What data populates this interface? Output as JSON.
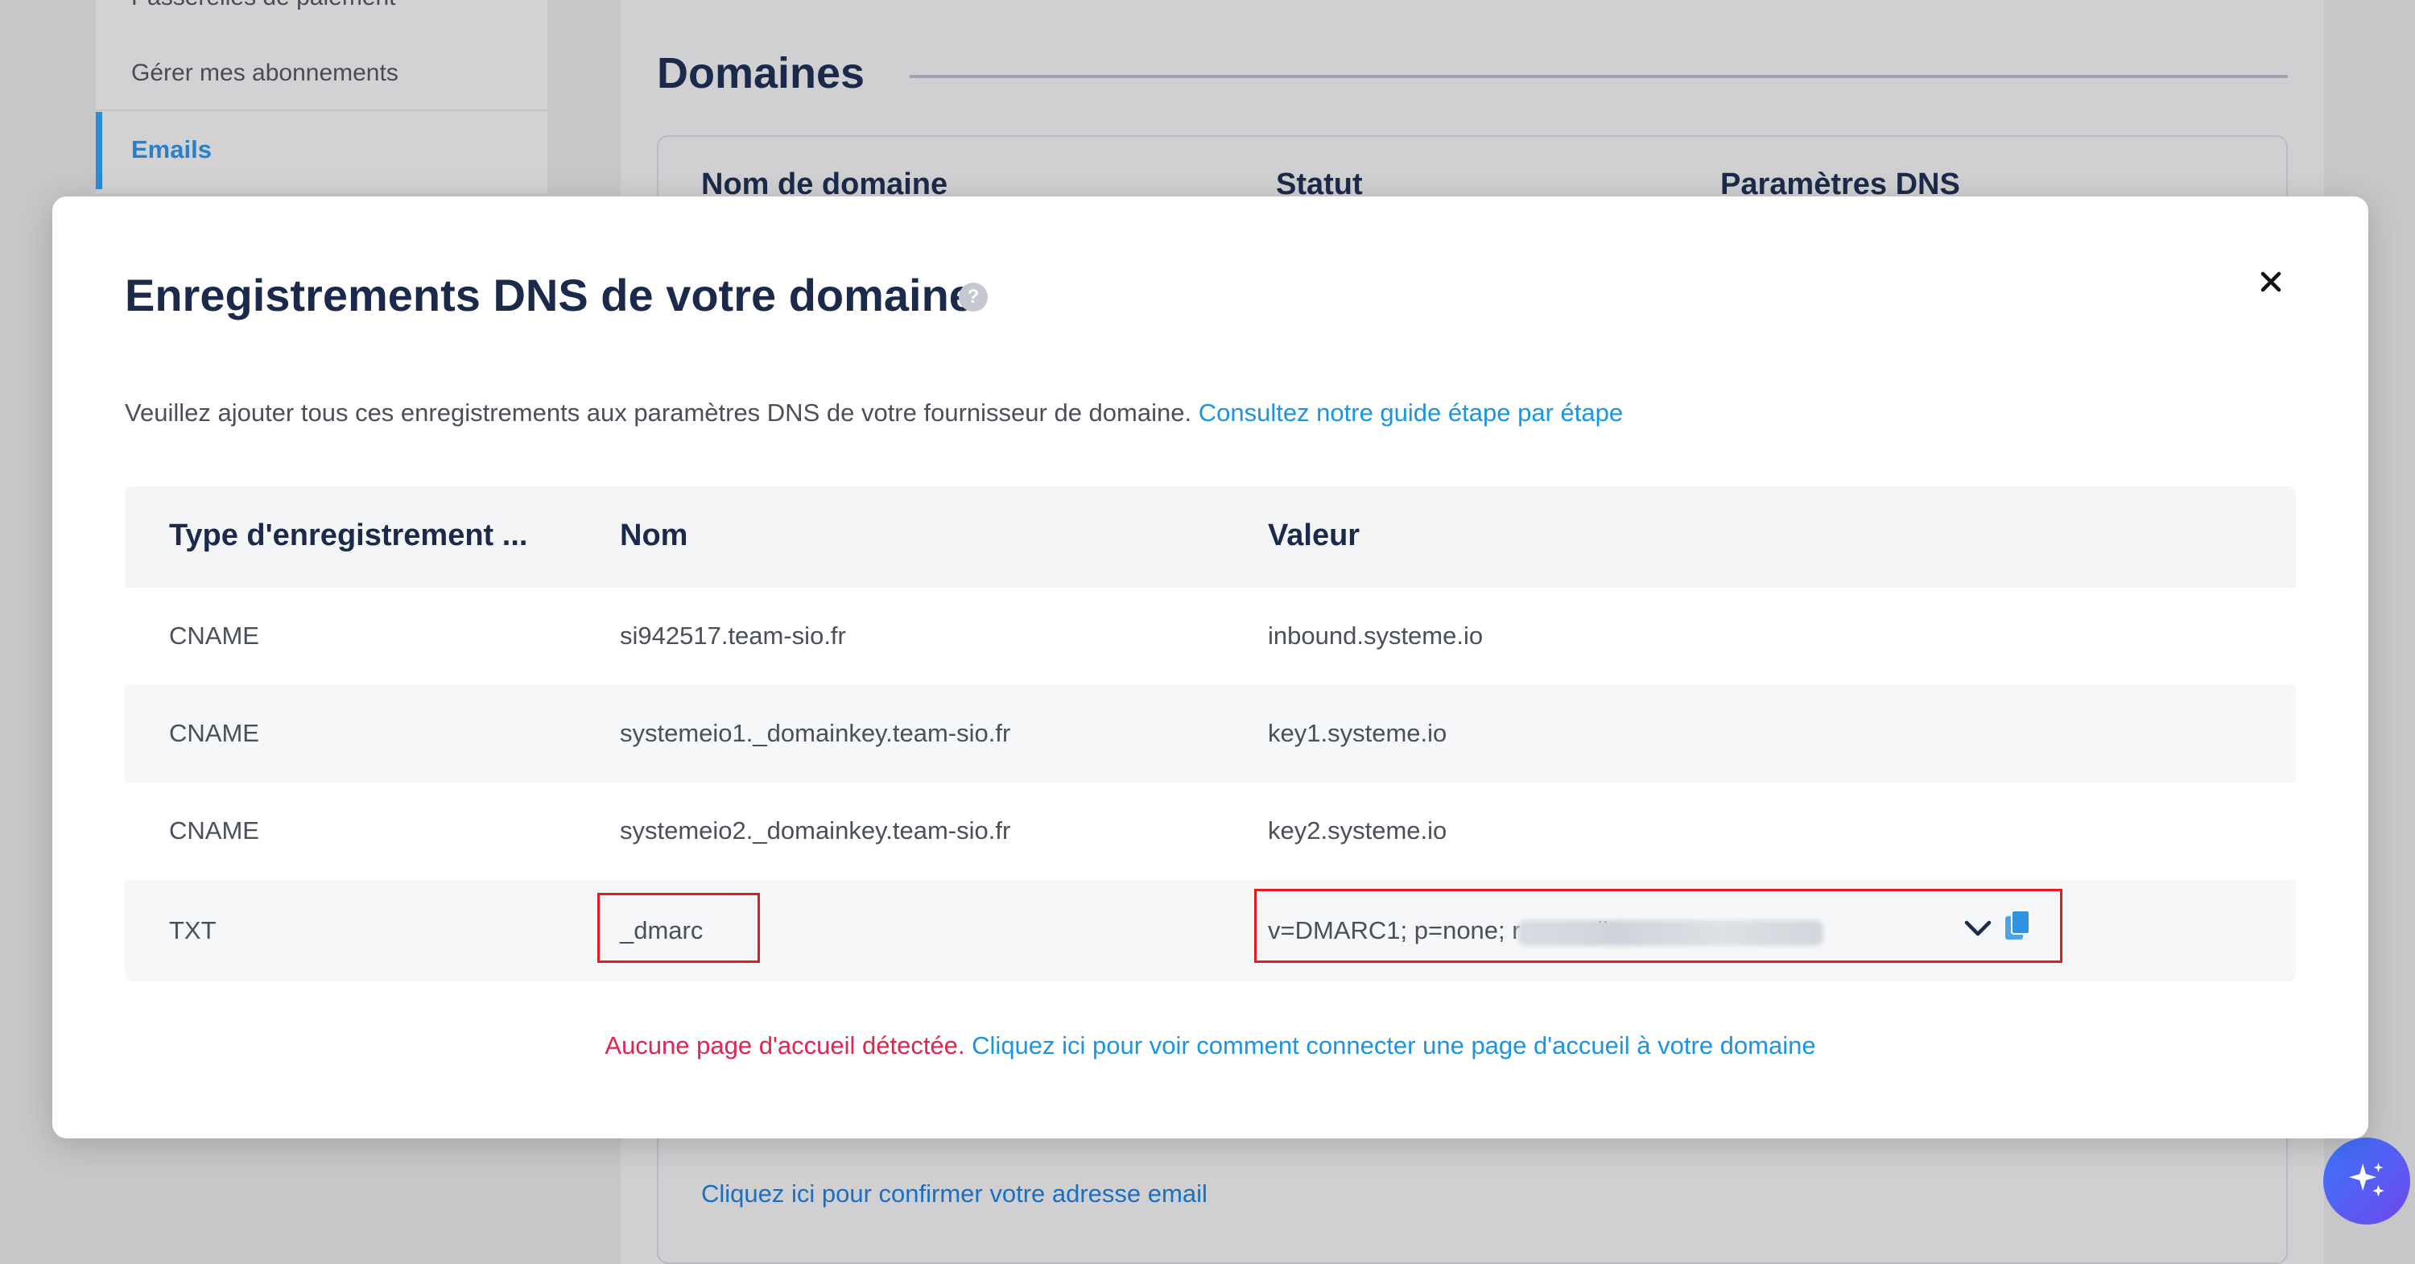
{
  "background": {
    "sidebar": {
      "items": [
        "Passerelles de paiement",
        "Gérer mes abonnements"
      ],
      "active_item": "Emails"
    },
    "section_title": "Domaines",
    "table_headers": [
      "Nom de domaine",
      "Statut",
      "Paramètres DNS"
    ],
    "confirm_email_link": "Cliquez ici pour confirmer votre adresse email"
  },
  "modal": {
    "title": "Enregistrements DNS de votre domaine",
    "help_icon": "?",
    "close_icon": "×",
    "description": "Veuillez ajouter tous ces enregistrements aux paramètres DNS de votre fournisseur de domaine.",
    "guide_link": "Consultez notre guide étape par étape",
    "table": {
      "headers": [
        "Type d'enregistrement ...",
        "Nom",
        "Valeur"
      ],
      "rows": [
        {
          "type": "CNAME",
          "name": "si942517.team-sio.fr",
          "value": "inbound.systeme.io"
        },
        {
          "type": "CNAME",
          "name": "systemeio1._domainkey.team-sio.fr",
          "value": "key1.systeme.io"
        },
        {
          "type": "CNAME",
          "name": "systemeio2._domainkey.team-sio.fr",
          "value": "key2.systeme.io"
        },
        {
          "type": "TXT",
          "name": "_dmarc",
          "value": "v=DMARC1; p=none; rua=mailto:"
        }
      ]
    },
    "footer_warning": "Aucune page d'accueil détectée.",
    "footer_link": "Cliquez ici pour voir comment connecter une page d'accueil à votre domaine"
  },
  "colors": {
    "title": "#1b2a4a",
    "link": "#1a95e0",
    "warning": "#e3244f",
    "highlight": "#e31d1d"
  },
  "icons": {
    "help": "question-circle-icon",
    "close": "close-icon",
    "dropdown": "chevron-down-icon",
    "copy": "copy-icon",
    "assistant": "sparkle-icon"
  }
}
